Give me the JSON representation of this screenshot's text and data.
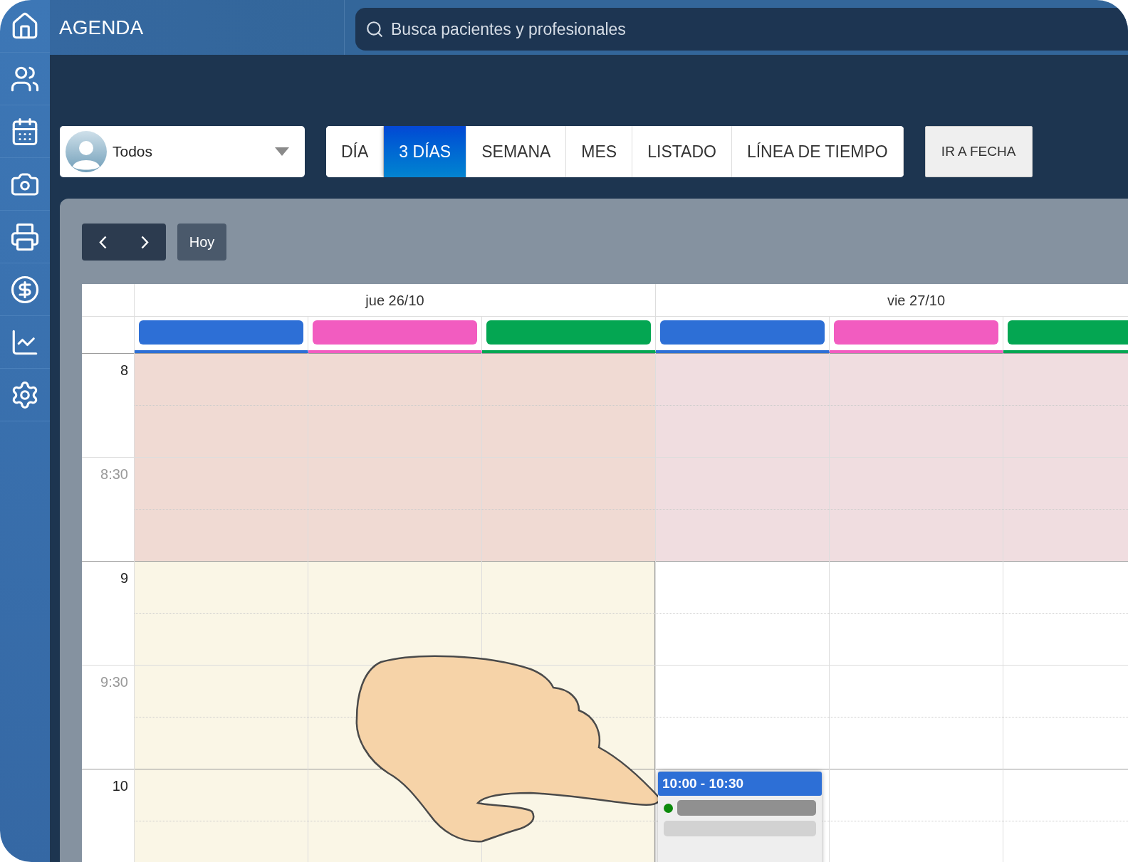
{
  "header": {
    "title": "AGENDA",
    "search": {
      "placeholder": "Busca pacientes y profesionales"
    }
  },
  "toolbar": {
    "professional_select": {
      "value": "Todos"
    },
    "views": [
      {
        "label": "DÍA",
        "selected": false
      },
      {
        "label": "3 DÍAS",
        "selected": true
      },
      {
        "label": "SEMANA",
        "selected": false
      },
      {
        "label": "MES",
        "selected": false
      },
      {
        "label": "LISTADO",
        "selected": false
      },
      {
        "label": "LÍNEA DE TIEMPO",
        "selected": false
      }
    ],
    "go_to_date": "IR A FECHA"
  },
  "calendar": {
    "today_button": "Hoy",
    "slots": [
      {
        "label": "8",
        "kind": "hour",
        "blocked": true
      },
      {
        "label": "8:30",
        "kind": "half",
        "blocked": true
      },
      {
        "label": "9",
        "kind": "hour",
        "blocked": false
      },
      {
        "label": "9:30",
        "kind": "half",
        "blocked": false
      },
      {
        "label": "10",
        "kind": "hour",
        "blocked": false
      }
    ],
    "days": [
      {
        "label": "jue 26/10",
        "today": true,
        "resources": [
          {
            "color": "#2d6fd6"
          },
          {
            "color": "#f25cc0"
          },
          {
            "color": "#04a652"
          }
        ]
      },
      {
        "label": "vie 27/10",
        "today": false,
        "resources": [
          {
            "color": "#2d6fd6",
            "events": [
              {
                "time": "10:00 - 10:30",
                "color": "#0b8a0b"
              }
            ]
          },
          {
            "color": "#f25cc0"
          },
          {
            "color": "#04a652"
          }
        ]
      }
    ]
  }
}
